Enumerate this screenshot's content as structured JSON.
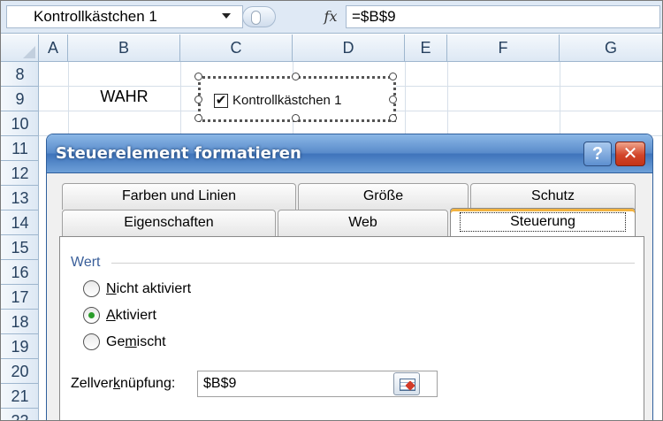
{
  "formula_bar": {
    "name_box": "Kontrollkästchen 1",
    "fx_symbol": "fx",
    "formula": "=$B$9"
  },
  "columns": [
    "A",
    "B",
    "C",
    "D",
    "E",
    "F",
    "G"
  ],
  "rows": [
    "8",
    "9",
    "10",
    "11",
    "12",
    "13",
    "14",
    "15",
    "16",
    "17",
    "18",
    "19",
    "20",
    "21",
    "22"
  ],
  "cells": {
    "B9": "WAHR"
  },
  "checkbox_control": {
    "label": "Kontrollkästchen 1",
    "checked": true,
    "check_glyph": "✔"
  },
  "dialog": {
    "title": "Steuerelement formatieren",
    "help_label": "?",
    "close_label": "✕",
    "tabs_top": [
      "Farben und Linien",
      "Größe",
      "Schutz"
    ],
    "tabs_bottom": [
      "Eigenschaften",
      "Web",
      "Steuerung"
    ],
    "active_tab": "Steuerung",
    "group_label": "Wert",
    "options": [
      {
        "prefix": "",
        "accel": "N",
        "rest": "icht aktiviert",
        "checked": false
      },
      {
        "prefix": "",
        "accel": "A",
        "rest": "ktiviert",
        "checked": true
      },
      {
        "prefix": "Ge",
        "accel": "m",
        "rest": "ischt",
        "checked": false
      }
    ],
    "link": {
      "label_prefix": "Zellver",
      "label_accel": "k",
      "label_rest": "nüpfung:",
      "value": "$B$9"
    }
  },
  "colors": {
    "titlebar": "#4f83c6",
    "close_button": "#d2452a",
    "active_tab_accent": "#f3b33f",
    "radio_dot": "#2a9d2a"
  }
}
